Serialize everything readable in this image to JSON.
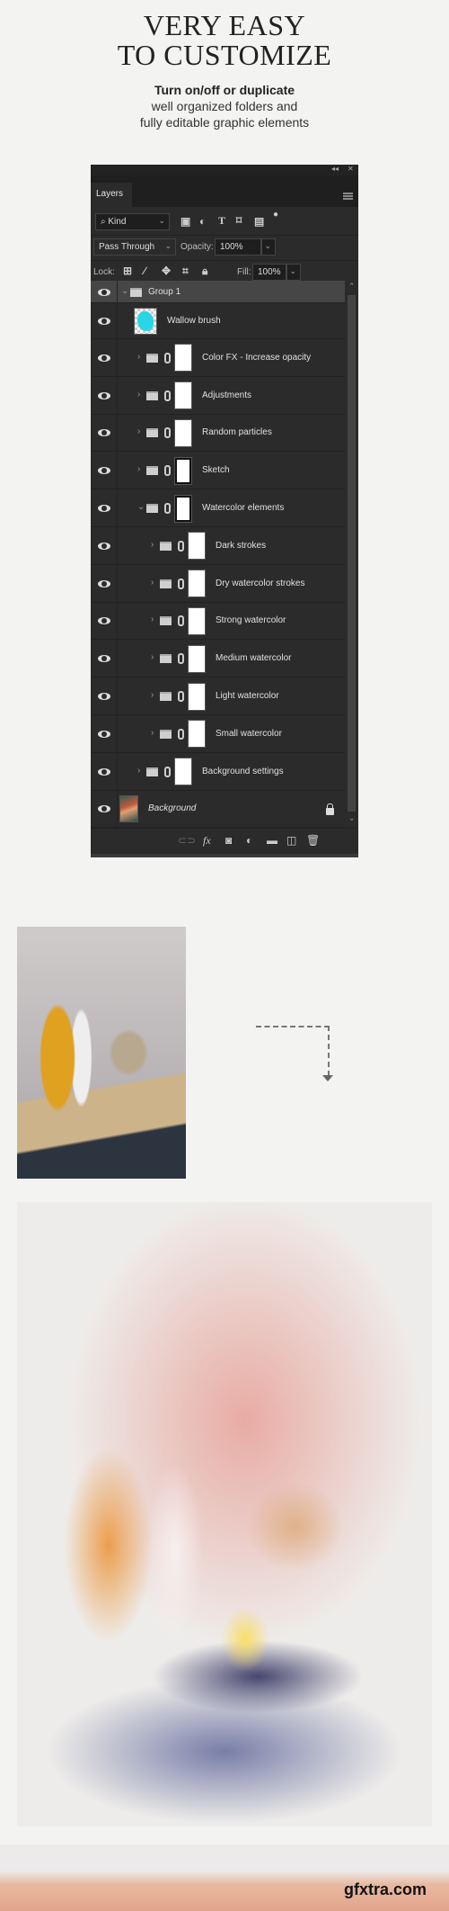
{
  "header": {
    "title_line1": "VERY EASY",
    "title_line2": "TO CUSTOMIZE",
    "subtitle_bold": "Turn on/off or duplicate",
    "subtitle_line2": "well organized folders and",
    "subtitle_line3": "fully editable graphic elements"
  },
  "panel": {
    "collapse_label": "◂◂",
    "close_label": "✕",
    "tab": "Layers",
    "filter": {
      "value": "Kind",
      "icons": [
        "image-filter-icon",
        "adjustment-filter-icon",
        "type-filter-icon",
        "shape-filter-icon",
        "smart-object-filter-icon",
        "filter-toggle-icon"
      ]
    },
    "blend_mode": "Pass Through",
    "opacity_label": "Opacity:",
    "opacity": "100%",
    "lock_label": "Lock:",
    "lock_icons": [
      "lock-transparent-icon",
      "lock-pixels-icon",
      "lock-position-icon",
      "lock-artboard-icon",
      "lock-all-icon"
    ],
    "fill_label": "Fill:",
    "fill": "100%",
    "layers": [
      {
        "name": "Group 1",
        "level": 0,
        "kind": "group",
        "expanded": true,
        "selected": true,
        "visible": true
      },
      {
        "name": "Wallow brush",
        "level": 1,
        "kind": "layer",
        "thumb": "brush",
        "visible": true
      },
      {
        "name": "Color FX - Increase opacity",
        "level": 1,
        "kind": "group",
        "expanded": false,
        "thumb": "white",
        "visible": true
      },
      {
        "name": "Adjustments",
        "level": 1,
        "kind": "group",
        "expanded": false,
        "thumb": "white",
        "visible": true
      },
      {
        "name": "Random particles",
        "level": 1,
        "kind": "group",
        "expanded": false,
        "thumb": "white",
        "visible": true
      },
      {
        "name": "Sketch",
        "level": 1,
        "kind": "group",
        "expanded": false,
        "thumb": "sketch",
        "visible": true
      },
      {
        "name": "Watercolor elements",
        "level": 1,
        "kind": "group",
        "expanded": true,
        "thumb": "sketch",
        "visible": true
      },
      {
        "name": "Dark strokes",
        "level": 2,
        "kind": "group",
        "expanded": false,
        "thumb": "white",
        "visible": true
      },
      {
        "name": "Dry watercolor strokes",
        "level": 2,
        "kind": "group",
        "expanded": false,
        "thumb": "white",
        "visible": true
      },
      {
        "name": "Strong watercolor",
        "level": 2,
        "kind": "group",
        "expanded": false,
        "thumb": "white",
        "visible": true
      },
      {
        "name": "Medium watercolor",
        "level": 2,
        "kind": "group",
        "expanded": false,
        "thumb": "white",
        "visible": true
      },
      {
        "name": "Light watercolor",
        "level": 2,
        "kind": "group",
        "expanded": false,
        "thumb": "white",
        "visible": true
      },
      {
        "name": "Small watercolor",
        "level": 2,
        "kind": "group",
        "expanded": false,
        "thumb": "white",
        "visible": true
      },
      {
        "name": "Background settings",
        "level": 1,
        "kind": "group",
        "expanded": false,
        "thumb": "white",
        "visible": true
      },
      {
        "name": "Background",
        "level": 0,
        "kind": "background",
        "thumb": "photo",
        "locked": true,
        "visible": true
      }
    ],
    "footer_icons": [
      "link-layers-icon",
      "fx-icon",
      "layer-mask-icon",
      "adjustment-layer-icon",
      "new-group-icon",
      "new-layer-icon",
      "trash-icon"
    ]
  },
  "colors": {
    "panel_bg": "#2b2b2b",
    "selected_row": "#464646",
    "brush_thumb": "#28d6e6"
  },
  "watermark": "gfxtra.com"
}
